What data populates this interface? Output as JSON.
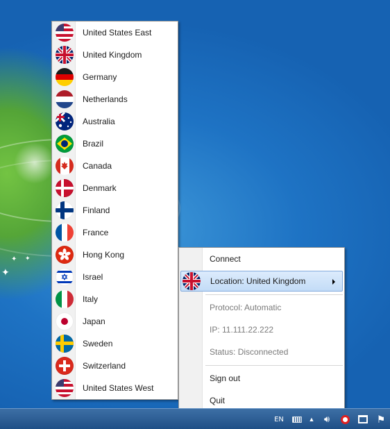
{
  "locations_menu": {
    "items": [
      {
        "label": "United States East",
        "icon": "us-flag-icon"
      },
      {
        "label": "United Kingdom",
        "icon": "uk-flag-icon"
      },
      {
        "label": "Germany",
        "icon": "germany-flag-icon"
      },
      {
        "label": "Netherlands",
        "icon": "netherlands-flag-icon"
      },
      {
        "label": "Australia",
        "icon": "australia-flag-icon"
      },
      {
        "label": "Brazil",
        "icon": "brazil-flag-icon"
      },
      {
        "label": "Canada",
        "icon": "canada-flag-icon"
      },
      {
        "label": "Denmark",
        "icon": "denmark-flag-icon"
      },
      {
        "label": "Finland",
        "icon": "finland-flag-icon"
      },
      {
        "label": "France",
        "icon": "france-flag-icon"
      },
      {
        "label": "Hong Kong",
        "icon": "hong-kong-flag-icon"
      },
      {
        "label": "Israel",
        "icon": "israel-flag-icon"
      },
      {
        "label": "Italy",
        "icon": "italy-flag-icon"
      },
      {
        "label": "Japan",
        "icon": "japan-flag-icon"
      },
      {
        "label": "Sweden",
        "icon": "sweden-flag-icon"
      },
      {
        "label": "Switzerland",
        "icon": "switzerland-flag-icon"
      },
      {
        "label": "United States West",
        "icon": "us-flag-icon"
      }
    ]
  },
  "context_menu": {
    "connect": "Connect",
    "location": "Location: United Kingdom",
    "location_icon": "uk-flag-icon",
    "protocol": "Protocol: Automatic",
    "ip": "IP:  11.111.22.222",
    "status": "Status: Disconnected",
    "sign_out": "Sign out",
    "quit": "Quit"
  },
  "taskbar": {
    "language": "EN",
    "icons": [
      "keyboard-icon",
      "show-hidden-icons-arrow",
      "volume-icon",
      "vpn-tray-icon",
      "network-icon",
      "action-center-flag-icon"
    ]
  },
  "colors": {
    "menu_highlight": "#c3dcf7",
    "menu_highlight_border": "#84acdd",
    "disabled_text": "#7a7a7a",
    "taskbar": "#1f4f86"
  }
}
